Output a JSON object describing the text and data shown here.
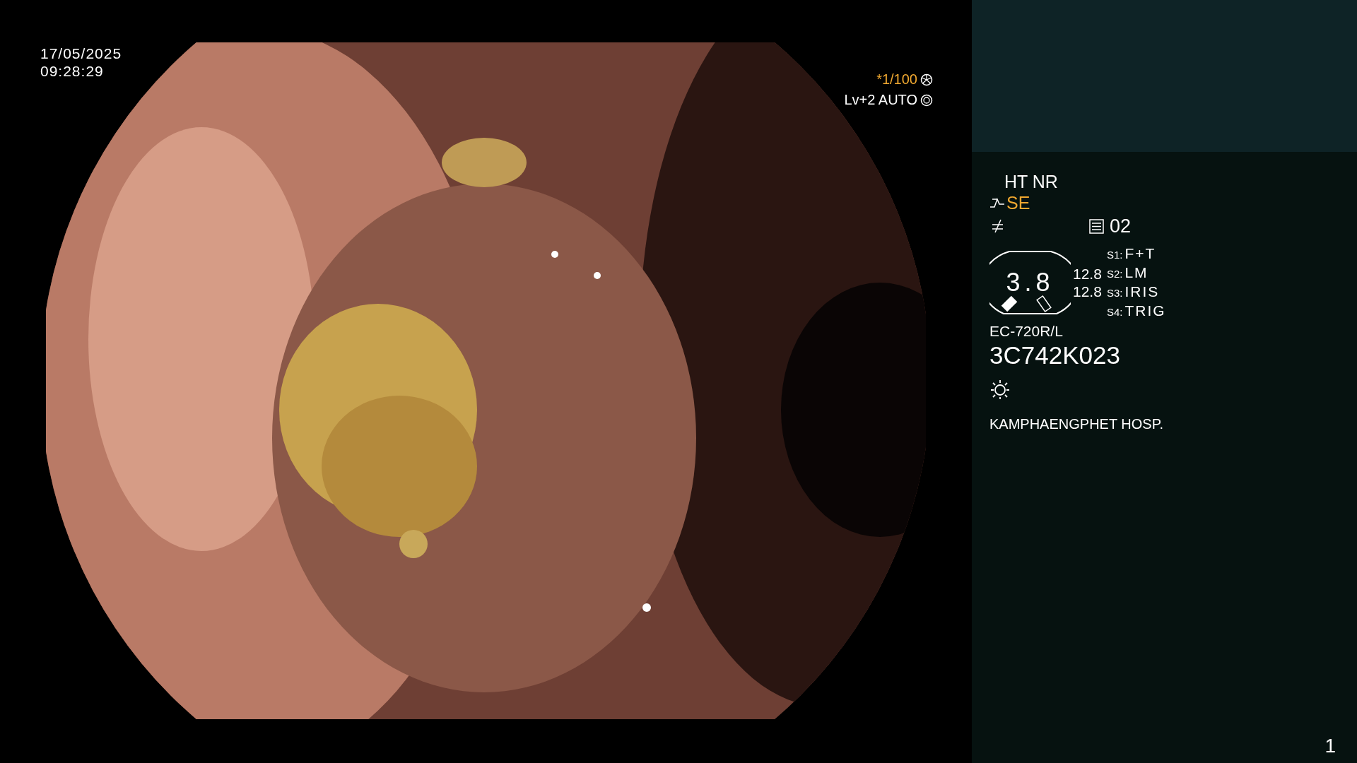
{
  "datetime": {
    "date": "17/05/2025",
    "time": "09:28:29"
  },
  "exposure": {
    "shutter": "*1/100",
    "brightness": "Lv+2 AUTO"
  },
  "panel": {
    "modes": "HT NR",
    "enhance": "SE",
    "preset": "02",
    "gauge": "3.8",
    "readings": [
      "12.8",
      "12.8"
    ],
    "switches": [
      {
        "label": "S1:",
        "function": "F+T"
      },
      {
        "label": "S2:",
        "function": "LM"
      },
      {
        "label": "S3:",
        "function": "IRIS"
      },
      {
        "label": "S4:",
        "function": "TRIG"
      }
    ],
    "scope_model": "EC-720R/L",
    "serial": "3C742K023",
    "hospital": "KAMPHAENGPHET HOSP."
  },
  "page_number": "1"
}
